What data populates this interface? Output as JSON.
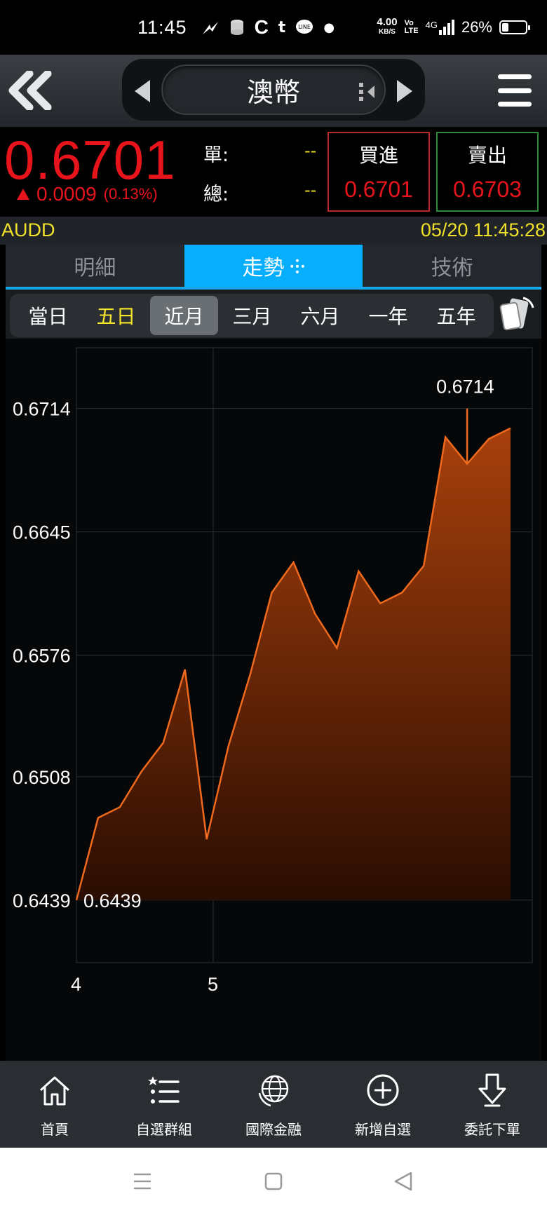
{
  "status_bar": {
    "time": "11:45",
    "net_speed": "4.00",
    "net_unit": "KB/S",
    "volte": "Vo LTE",
    "network": "4G",
    "battery_pct": "26%"
  },
  "header": {
    "title": "澳幣"
  },
  "quote": {
    "price": "0.6701",
    "change": "0.0009",
    "change_pct": "(0.13%)",
    "label_single": "單:",
    "label_total": "總:",
    "value_single": "--",
    "value_total": "--",
    "buy_label": "買進",
    "buy_price": "0.6701",
    "sell_label": "賣出",
    "sell_price": "0.6703",
    "up_color": "#e8141b"
  },
  "code_row": {
    "symbol": "AUDD",
    "datetime": "05/20 11:45:28"
  },
  "tabs": [
    {
      "label": "明細"
    },
    {
      "label": "走勢"
    },
    {
      "label": "技術"
    }
  ],
  "periods": [
    {
      "label": "當日"
    },
    {
      "label": "五日"
    },
    {
      "label": "近月"
    },
    {
      "label": "三月"
    },
    {
      "label": "六月"
    },
    {
      "label": "一年"
    },
    {
      "label": "五年"
    }
  ],
  "chart_data": {
    "type": "area",
    "x_ticks": [
      "4",
      "5"
    ],
    "y_ticks": [
      "0.6714",
      "0.6645",
      "0.6576",
      "0.6508",
      "0.6439"
    ],
    "ylim": [
      0.6404,
      0.6748
    ],
    "max_label": "0.6714",
    "min_label": "0.6439",
    "series": [
      {
        "values": [
          0.6439,
          0.6485,
          0.6491,
          0.6511,
          0.6527,
          0.6568,
          0.6473,
          0.6525,
          0.6565,
          0.6611,
          0.6628,
          0.6599,
          0.658,
          0.6623,
          0.6605,
          0.6611,
          0.6626,
          0.6698,
          0.6683,
          0.6697,
          0.6703
        ]
      }
    ],
    "line_color": "#f06a1d",
    "grid": true
  },
  "bottom_nav": [
    {
      "label": "首頁",
      "icon": "home-icon"
    },
    {
      "label": "自選群組",
      "icon": "list-star-icon"
    },
    {
      "label": "國際金融",
      "icon": "globe-icon"
    },
    {
      "label": "新增自選",
      "icon": "plus-circle-icon"
    },
    {
      "label": "委託下單",
      "icon": "download-arrow-icon"
    }
  ]
}
